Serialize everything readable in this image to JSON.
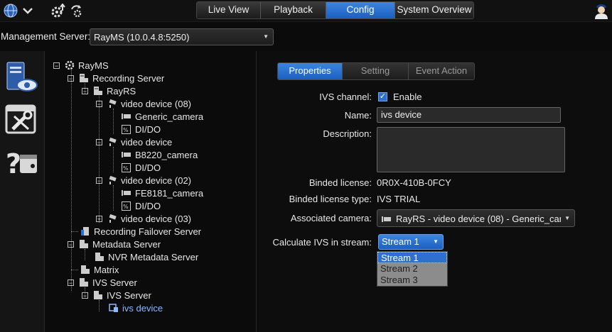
{
  "topbar": {
    "nav_tabs": [
      "Live View",
      "Playback",
      "Config",
      "System Overview"
    ],
    "active_tab": "Config"
  },
  "server": {
    "label": "Management Server:",
    "value": "RayMS (10.0.4.8:5250)"
  },
  "tree": {
    "root": "RayMS",
    "recording_server": "Recording Server",
    "rayrs": "RayRS",
    "video_device_08": "video device (08)",
    "generic_camera": "Generic_camera",
    "di_do_1": "DI/DO",
    "video_device": "video device",
    "b8220_camera": "B8220_camera",
    "di_do_2": "DI/DO",
    "video_device_02": "video device (02)",
    "fe8181_camera": "FE8181_camera",
    "di_do_3": "DI/DO",
    "video_device_03": "video device (03)",
    "recording_failover": "Recording Failover Server",
    "metadata_server": "Metadata Server",
    "nvr_metadata_server": "NVR Metadata Server",
    "matrix": "Matrix",
    "ivs_server": "IVS Server",
    "ivs_server_child": "IVS Server",
    "ivs_device": "ivs device"
  },
  "panel": {
    "tabs": [
      "Properties",
      "Setting",
      "Event Action"
    ],
    "active_tab": "Properties",
    "ivs_channel_label": "IVS channel:",
    "enable_label": "Enable",
    "enable_checked": true,
    "name_label": "Name:",
    "name_value": "ivs device",
    "description_label": "Description:",
    "description_value": "",
    "binded_license_label": "Binded license:",
    "binded_license_value": "0R0X-410B-0FCY",
    "binded_license_type_label": "Binded license type:",
    "binded_license_type_value": "IVS TRIAL",
    "associated_camera_label": "Associated camera:",
    "associated_camera_value": "RayRS - video device (08) - Generic_can",
    "calc_stream_label": "Calculate IVS in stream:",
    "calc_stream_value": "Stream 1",
    "stream_options": [
      "Stream 1",
      "Stream 2",
      "Stream 3"
    ]
  },
  "colors": {
    "accent": "#2f6fd0",
    "background": "#0b0b0b",
    "selected_tree_text": "#8fb8ff"
  }
}
